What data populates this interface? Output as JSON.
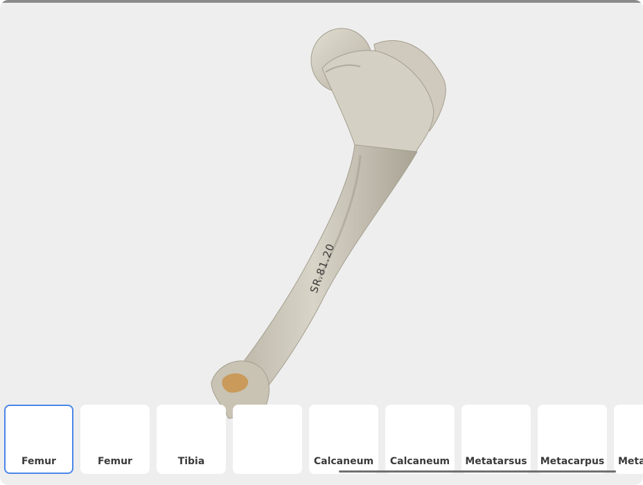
{
  "viewer": {
    "model_object": "femur-bone",
    "specimen_label": "SR.81.20"
  },
  "thumbnails": [
    {
      "label": "Femur",
      "selected": true
    },
    {
      "label": "Femur",
      "selected": false
    },
    {
      "label": "Tibia",
      "selected": false
    },
    {
      "label": "",
      "selected": false
    },
    {
      "label": "Calcaneum",
      "selected": false
    },
    {
      "label": "Calcaneum",
      "selected": false
    },
    {
      "label": "Metatarsus",
      "selected": false
    },
    {
      "label": "Metacarpus",
      "selected": false
    },
    {
      "label": "Meta",
      "selected": false
    }
  ],
  "colors": {
    "background": "#eeeeee",
    "accent": "#4a86e8",
    "label_text": "#3a3a3a"
  }
}
